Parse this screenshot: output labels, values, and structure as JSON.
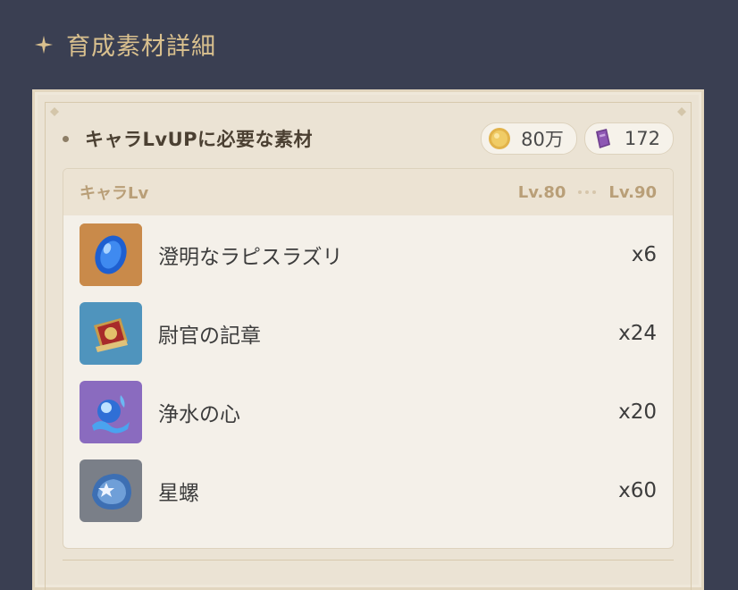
{
  "header": {
    "title": "育成素材詳細",
    "icon": "sparkle-icon"
  },
  "section": {
    "title": "キャラLvUPに必要な素材",
    "costs": [
      {
        "icon": "mora-coin-icon",
        "value": "80万"
      },
      {
        "icon": "exp-book-icon",
        "value": "172"
      }
    ]
  },
  "table": {
    "header_label": "キャラLv",
    "level_from": "Lv.80",
    "level_to": "Lv.90",
    "rows": [
      {
        "icon": "lapis-lazuli-gem-icon",
        "name": "澄明なラピスラズリ",
        "qty": "x6",
        "bg": "#c98a4a"
      },
      {
        "icon": "insignia-icon",
        "name": "尉官の記章",
        "qty": "x24",
        "bg": "#4f94bd"
      },
      {
        "icon": "water-heart-icon",
        "name": "浄水の心",
        "qty": "x20",
        "bg": "#8a6bbf"
      },
      {
        "icon": "starconch-icon",
        "name": "星螺",
        "qty": "x60",
        "bg": "#7a7f88"
      }
    ]
  },
  "colors": {
    "page_bg": "#3a3f52",
    "panel_bg": "#ebe3d4",
    "accent_gold": "#d9c08e",
    "label_brown": "#b99f78"
  }
}
